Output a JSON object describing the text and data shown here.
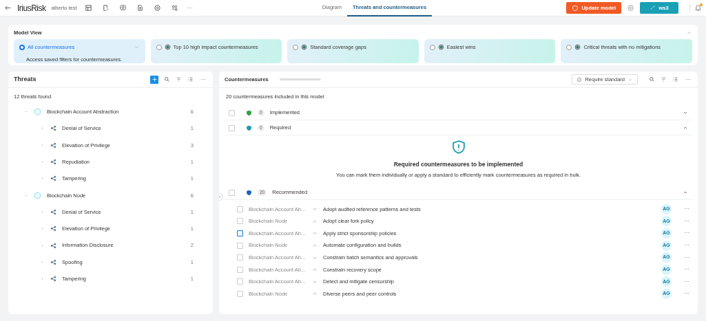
{
  "topbar": {
    "logo": "IriusRisk",
    "project": "alberto test",
    "more": "···",
    "tabs": [
      {
        "label": "Diagram",
        "selected": false
      },
      {
        "label": "Threats and countermeasures",
        "selected": true
      }
    ],
    "update_button": "Update model",
    "workspace_button": "ws3",
    "notification": true
  },
  "model_view": {
    "title": "Model View",
    "expanded": true,
    "options": [
      {
        "label": "All countermeasures",
        "description": "Access saved filters for countermeasures.",
        "selected": true,
        "kind": "dropdown"
      },
      {
        "label": "Top 10 high impact countermeasures",
        "selected": false,
        "kind": "preset"
      },
      {
        "label": "Standard coverage gaps",
        "selected": false,
        "kind": "preset"
      },
      {
        "label": "Easiest wins",
        "selected": false,
        "kind": "preset"
      },
      {
        "label": "Critical threats with no mitigations",
        "selected": false,
        "kind": "preset"
      }
    ]
  },
  "threats": {
    "title": "Threats",
    "count_text": "12 threats found",
    "more": "···",
    "tree": [
      {
        "label": "Blockchain Account Abstraction",
        "count": "6",
        "expanded": true,
        "children": [
          {
            "label": "Denial of Service",
            "count": "1",
            "expanded": false
          },
          {
            "label": "Elevation of Privilege",
            "count": "3",
            "expanded": false
          },
          {
            "label": "Repudiation",
            "count": "1",
            "expanded": false
          },
          {
            "label": "Tampering",
            "count": "1",
            "expanded": false
          }
        ]
      },
      {
        "label": "Blockchain Node",
        "count": "6",
        "expanded": true,
        "children": [
          {
            "label": "Denial of Service",
            "count": "1",
            "expanded": false
          },
          {
            "label": "Elevation of Privilege",
            "count": "1",
            "expanded": false
          },
          {
            "label": "Information Disclosure",
            "count": "2",
            "expanded": false
          },
          {
            "label": "Spoofing",
            "count": "1",
            "expanded": false
          },
          {
            "label": "Tampering",
            "count": "1",
            "expanded": false
          }
        ]
      }
    ]
  },
  "countermeasures": {
    "title": "Countermeasures",
    "standard_button": "Require standard",
    "summary": "20 countermeasures included in this model",
    "more": "···",
    "sections": [
      {
        "label": "Implemented",
        "count": "0",
        "color": "#2e9e3e",
        "expanded": false,
        "checked": false
      },
      {
        "label": "Required",
        "count": "0",
        "color": "#1f9bb0",
        "expanded": true,
        "checked": false,
        "empty_title": "Required countermeasures to be implemented",
        "empty_text": "You can mark them individually or apply a standard to efficiently mark countermeasures as required in bulk."
      },
      {
        "label": "Recommended",
        "count": "20",
        "color": "#1565c0",
        "expanded": true,
        "checked": false,
        "rows": [
          {
            "component": "Blockchain Account Ab...",
            "name": "Adopt audited reference patterns and tests",
            "owner": "AG",
            "focused": false
          },
          {
            "component": "Blockchain Node",
            "name": "Adopt clear fork policy",
            "owner": "AG",
            "focused": false
          },
          {
            "component": "Blockchain Account Ab...",
            "name": "Apply strict sponsorship policies",
            "owner": "AG",
            "focused": true
          },
          {
            "component": "Blockchain Node",
            "name": "Automate configuration and builds",
            "owner": "AG",
            "focused": false
          },
          {
            "component": "Blockchain Account Ab...",
            "name": "Constrain batch semantics and approvals",
            "owner": "AG",
            "focused": false
          },
          {
            "component": "Blockchain Account Ab...",
            "name": "Constrain recovery scope",
            "owner": "AG",
            "focused": false
          },
          {
            "component": "Blockchain Account Ab...",
            "name": "Detect and mitigate censorship",
            "owner": "AG",
            "focused": false
          },
          {
            "component": "Blockchain Node",
            "name": "Diverse peers and peer controls",
            "owner": "AG",
            "focused": false
          }
        ]
      }
    ]
  }
}
